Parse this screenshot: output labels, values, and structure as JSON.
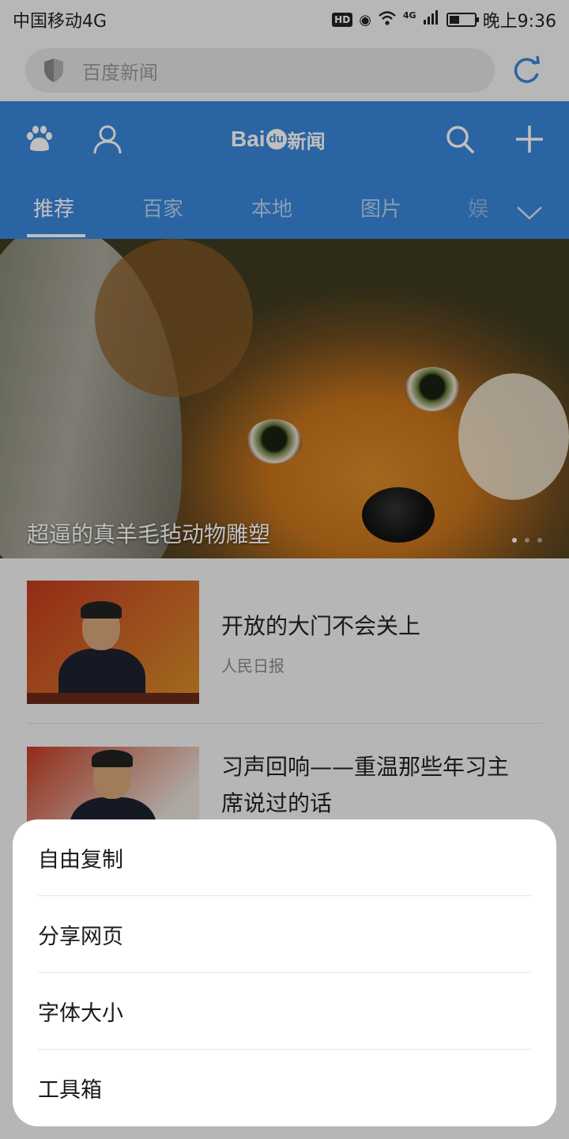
{
  "status_bar": {
    "carrier": "中国移动4G",
    "hd_badge": "HD",
    "network": "4G",
    "time": "晚上9:36",
    "battery_level": 0.35
  },
  "url_bar": {
    "text": "百度新闻",
    "shield_icon": "shield-icon",
    "refresh_icon": "refresh-icon"
  },
  "header": {
    "logo_text_1": "Bai",
    "logo_du": "du",
    "logo_text_2": "新闻",
    "icons": [
      "paw-icon",
      "user-icon",
      "search-icon",
      "plus-icon"
    ]
  },
  "tabs": {
    "items": [
      "推荐",
      "百家",
      "本地",
      "图片",
      "娱"
    ],
    "active_index": 0,
    "more_icon": "chevron-down-icon"
  },
  "hero": {
    "caption": "超逼的真羊毛毡动物雕塑",
    "page_count": 3,
    "current_page": 1
  },
  "news": [
    {
      "title": "开放的大门不会关上",
      "source": "人民日报"
    },
    {
      "title_line1": "习声回响——重温那些年习主",
      "title_line2": "席说过的话"
    }
  ],
  "sheet": {
    "items": [
      "自由复制",
      "分享网页",
      "字体大小",
      "工具箱"
    ]
  },
  "colors": {
    "brand_blue": "#3a86d9",
    "tab_inactive": "#b6d2f2"
  }
}
